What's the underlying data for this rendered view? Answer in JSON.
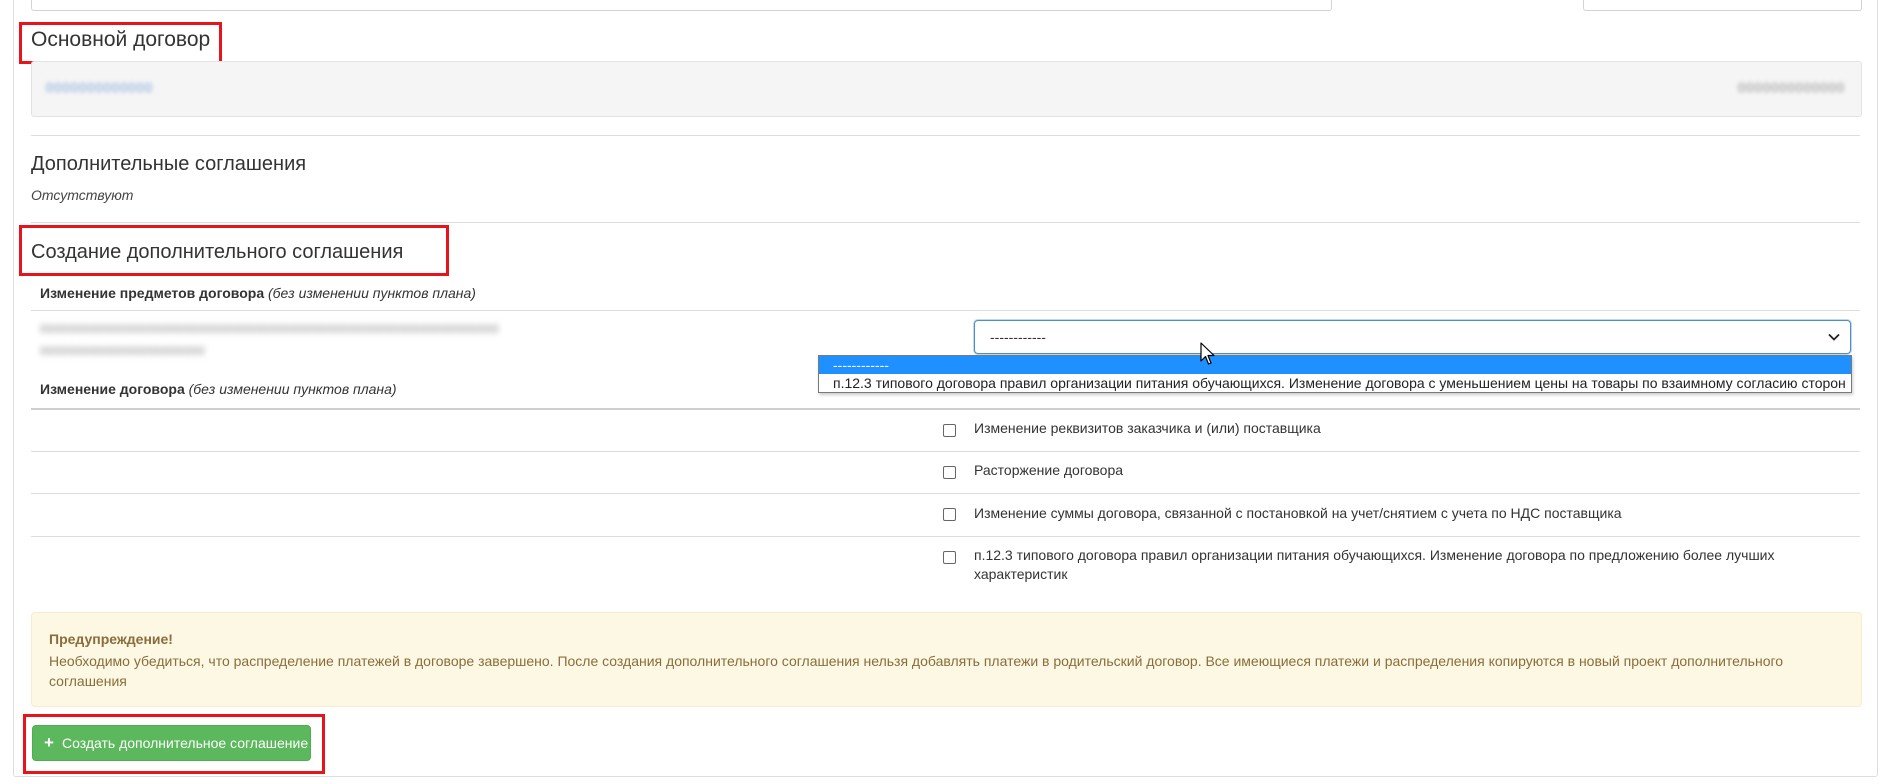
{
  "main_contract": {
    "heading": "Основной договор",
    "value_left": "0000000000000",
    "value_right": "0000000000000"
  },
  "supplementary": {
    "heading": "Дополнительные соглашения",
    "status": "Отсутствуют"
  },
  "create": {
    "heading": "Создание дополнительного соглашения",
    "subjects_change_title": "Изменение предметов договора",
    "subjects_change_note": "(без изменении пунктов плана)",
    "item_line1": "0000000000000000000000000000000000000000000000000000000000000000",
    "item_line2": "00000000000000000000000",
    "select_value": "------------",
    "dropdown_options": [
      "------------",
      "п.12.3 типового договора правил организации питания обучающихся. Изменение договора с уменьшением цены на товары по взаимному согласию сторон"
    ],
    "contract_change_title": "Изменение договора",
    "contract_change_note": "(без изменении пунктов плана)",
    "checkboxes": [
      "Изменение реквизитов заказчика и (или) поставщика",
      "Расторжение договора",
      "Изменение суммы договора, связанной с постановкой на учет/снятием с учета по НДС поставщика",
      "п.12.3 типового договора правил организации питания обучающихся. Изменение договора по предложению более лучших характеристик"
    ]
  },
  "warning": {
    "title": "Предупреждение!",
    "text": "Необходимо убедиться, что распределение платежей в договоре завершено. После создания дополнительного соглашения нельзя добавлять платежи в родительский договор. Все имеющиеся платежи и распределения копируются в новый проект дополнительного соглашения"
  },
  "create_button": {
    "icon": "plus-icon",
    "label": "Создать дополнительное соглашение"
  },
  "colors": {
    "highlight_box": "#e8141d",
    "button_green": "#5cb85c",
    "warning_bg": "#fcf8e3",
    "warning_text": "#8a6d3b",
    "select_border": "#4d90c9",
    "dropdown_selected": "#1e90ff"
  }
}
